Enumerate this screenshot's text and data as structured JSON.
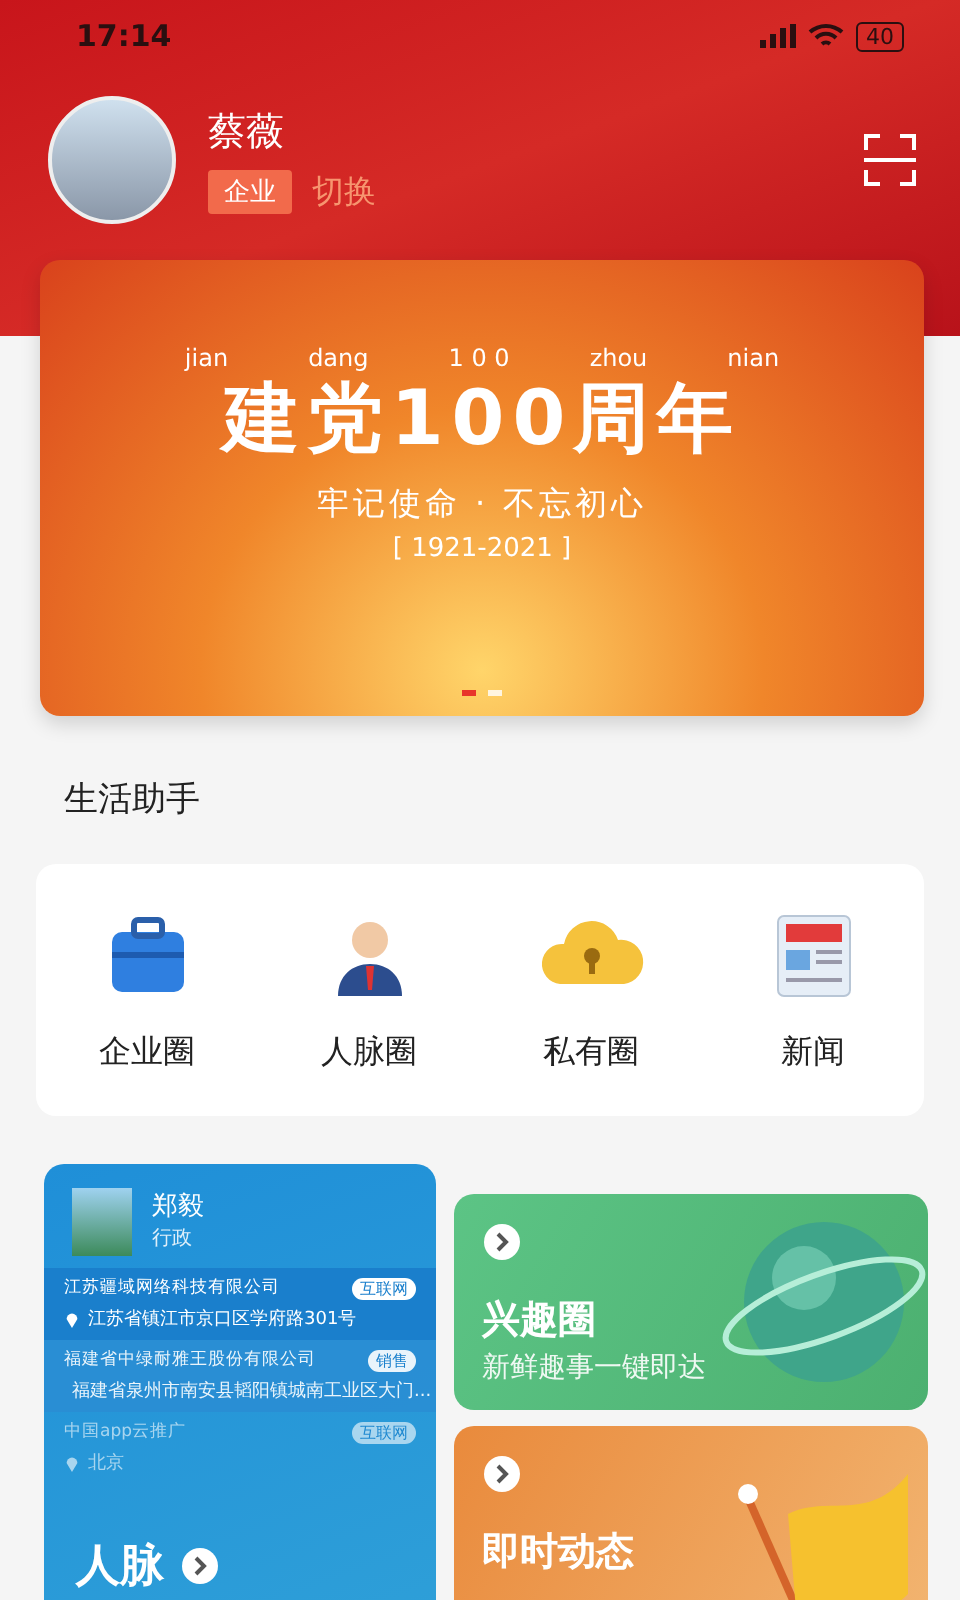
{
  "status_bar": {
    "time": "17:14",
    "battery": "40"
  },
  "user": {
    "name": "蔡薇",
    "badge": "企业",
    "switch_label": "切换"
  },
  "banner": {
    "pinyin": [
      "jian",
      "dang",
      "1 0 0",
      "zhou",
      "nian"
    ],
    "title": "建党100周年",
    "subtitle": "牢记使命 · 不忘初心",
    "years": "[ 1921-2021 ]",
    "dots": [
      {
        "selected": true
      },
      {
        "selected": false
      }
    ]
  },
  "section_title": "生活助手",
  "shortcuts": [
    {
      "kind": "briefcase",
      "label": "企业圈"
    },
    {
      "kind": "person",
      "label": "人脉圈"
    },
    {
      "kind": "lock",
      "label": "私有圈"
    },
    {
      "kind": "news",
      "label": "新闻"
    }
  ],
  "contacts_card": {
    "name": "郑毅",
    "role": "行政",
    "entries": [
      {
        "company": "江苏疆域网络科技有限公司",
        "tag": "互联网",
        "address": "江苏省镇江市京口区学府路301号"
      },
      {
        "company": "福建省中绿耐雅王股份有限公司",
        "tag": "销售",
        "address": "福建省泉州市南安县韬阳镇城南工业区大门..."
      },
      {
        "company": "中国app云推广",
        "tag": "互联网",
        "address": "北京"
      }
    ],
    "title": "人脉"
  },
  "feature_cards": [
    {
      "kind": "globe",
      "title": "兴趣圈",
      "subtitle": "新鲜趣事一键即达"
    },
    {
      "kind": "flag",
      "title": "即时动态"
    }
  ]
}
